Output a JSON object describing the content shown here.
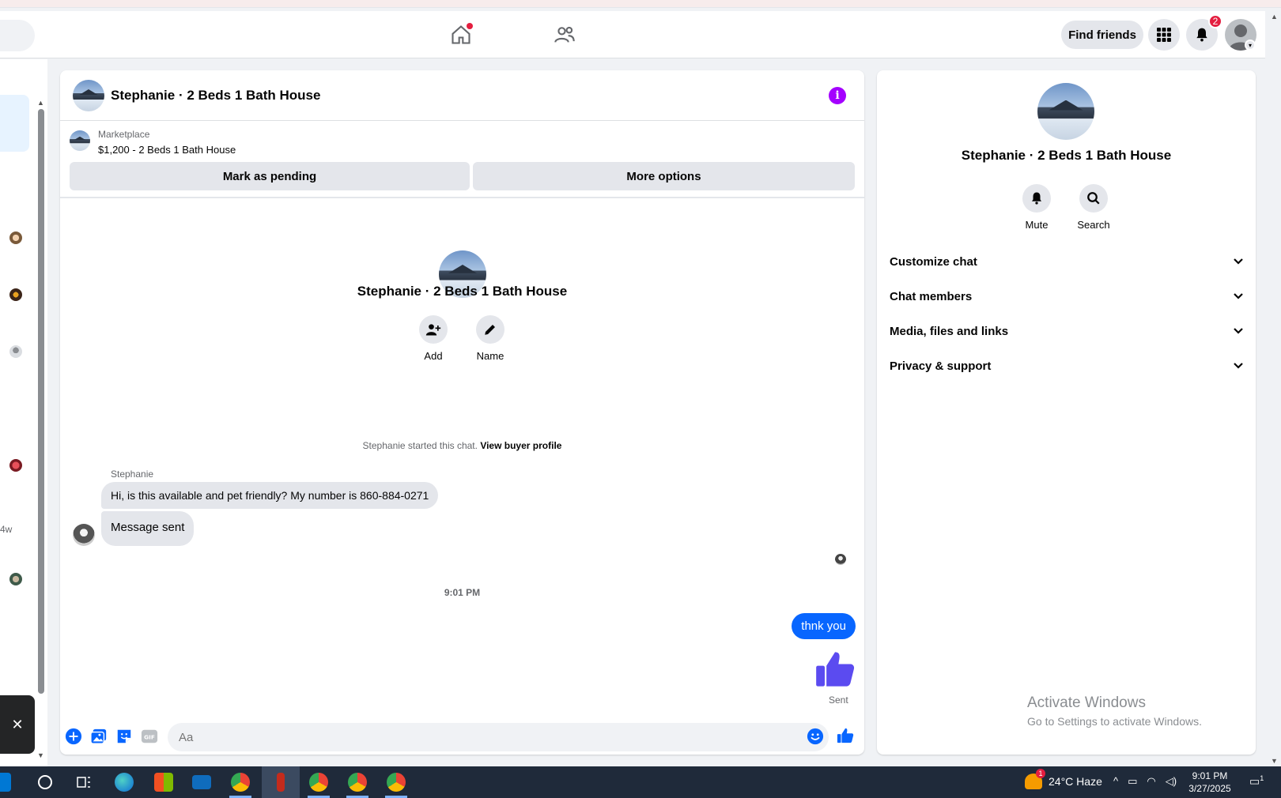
{
  "header": {
    "find_friends": "Find friends",
    "notification_count": "2"
  },
  "sidebar": {
    "time_label": "4w"
  },
  "chat": {
    "title": "Stephanie · 2 Beds 1 Bath House",
    "marketplace_label": "Marketplace",
    "listing": "$1,200 - 2 Beds 1 Bath House",
    "mark_pending": "Mark as pending",
    "more_options": "More options",
    "center_title": "Stephanie · 2 Beds 1 Bath House",
    "actions": [
      {
        "label": "Add",
        "icon": "add-person-icon"
      },
      {
        "label": "Name",
        "icon": "pencil-icon"
      }
    ],
    "started_text": "Stephanie started this chat.",
    "view_buyer": "View buyer profile",
    "sender": "Stephanie",
    "messages_in": [
      "Hi, is this available and pet friendly? My number is 860-884-0271",
      "Message sent"
    ],
    "timestamp": "9:01 PM",
    "message_out": "thnk you",
    "sent_status": "Sent",
    "composer_placeholder": "Aa"
  },
  "info_panel": {
    "title": "Stephanie · 2 Beds 1 Bath House",
    "mute": "Mute",
    "search": "Search",
    "sections": [
      "Customize chat",
      "Chat members",
      "Media, files and links",
      "Privacy & support"
    ]
  },
  "watermark": {
    "line1": "Activate Windows",
    "line2": "Go to Settings to activate Windows."
  },
  "taskbar": {
    "weather_alert": "1",
    "weather": "24°C  Haze",
    "time": "9:01 PM",
    "date": "3/27/2025",
    "action_badge": "1"
  },
  "colors": {
    "accent": "#0866ff",
    "info": "#a400ff",
    "badge": "#e41e3f"
  }
}
